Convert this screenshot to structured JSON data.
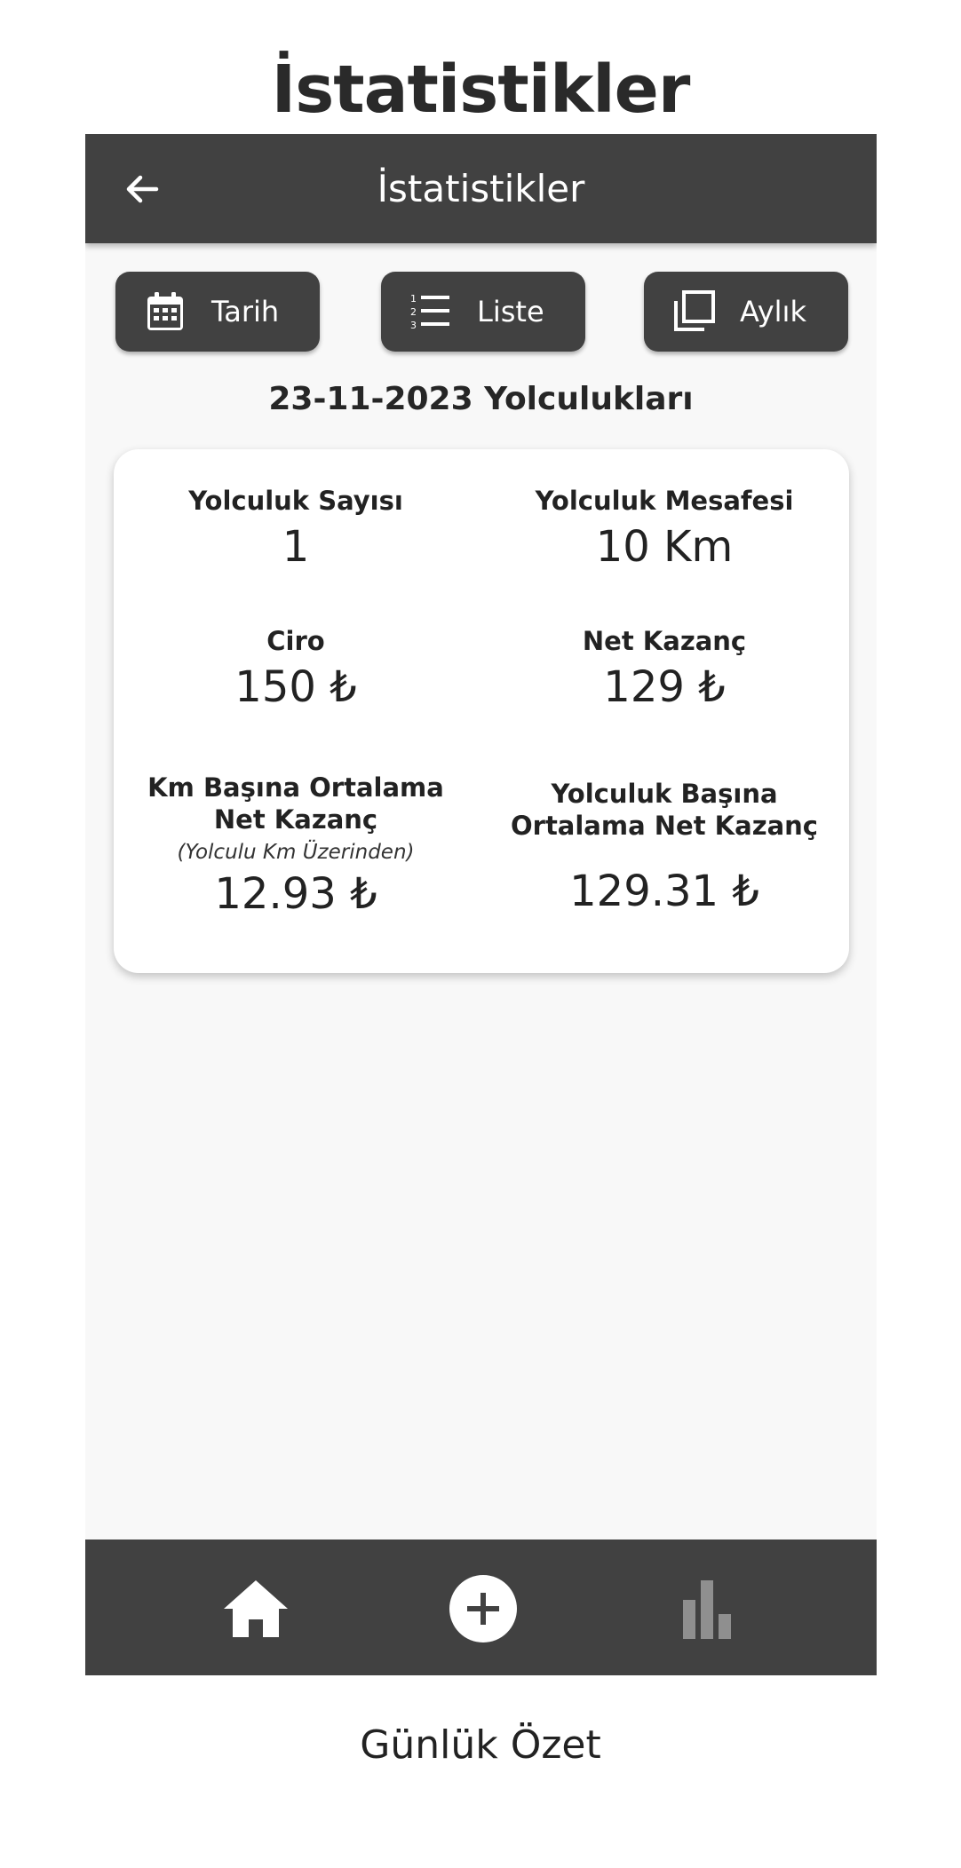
{
  "caption": {
    "title": "İstatistikler",
    "bottom": "Günlük Özet"
  },
  "appbar": {
    "title": "İstatistikler",
    "back_icon": "arrow-back-icon"
  },
  "buttons": {
    "date_label": "Tarih",
    "list_label": "Liste",
    "monthly_label": "Aylık"
  },
  "section": {
    "title": "23-11-2023 Yolculukları"
  },
  "stats": {
    "trip_count": {
      "label": "Yolculuk Sayısı",
      "value": "1"
    },
    "trip_distance": {
      "label": "Yolculuk Mesafesi",
      "value": "10 Km"
    },
    "revenue": {
      "label": "Ciro",
      "value": "150 ₺"
    },
    "net_income": {
      "label": "Net Kazanç",
      "value": "129 ₺"
    },
    "avg_per_km": {
      "label_line1": "Km Başına Ortalama",
      "label_line2": "Net Kazanç",
      "sub": "(Yolculu Km Üzerinden)",
      "value": "12.93 ₺"
    },
    "avg_per_trip": {
      "label_line1": "Yolculuk Başına",
      "label_line2": "Ortalama Net Kazanç",
      "value": "129.31 ₺"
    }
  },
  "bottom_nav": {
    "items": [
      "home-icon",
      "add-circle-icon",
      "bar-chart-icon"
    ],
    "active": "bar-chart-icon"
  },
  "colors": {
    "bar": "#414141",
    "background": "#f8f8f8",
    "card": "#ffffff",
    "icon_active": "#ffffff",
    "icon_inactive": "#8f8f8f"
  }
}
